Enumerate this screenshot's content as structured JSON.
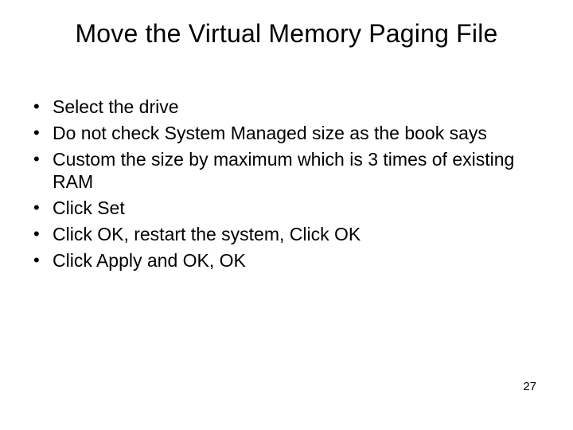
{
  "title": "Move the Virtual Memory Paging File",
  "bullets": [
    "Select the drive",
    "Do not check System Managed size as the book says",
    "Custom the size by maximum which is 3 times of existing RAM",
    "Click Set",
    "Click OK, restart the system, Click OK",
    "Click Apply and OK, OK"
  ],
  "page_number": "27"
}
